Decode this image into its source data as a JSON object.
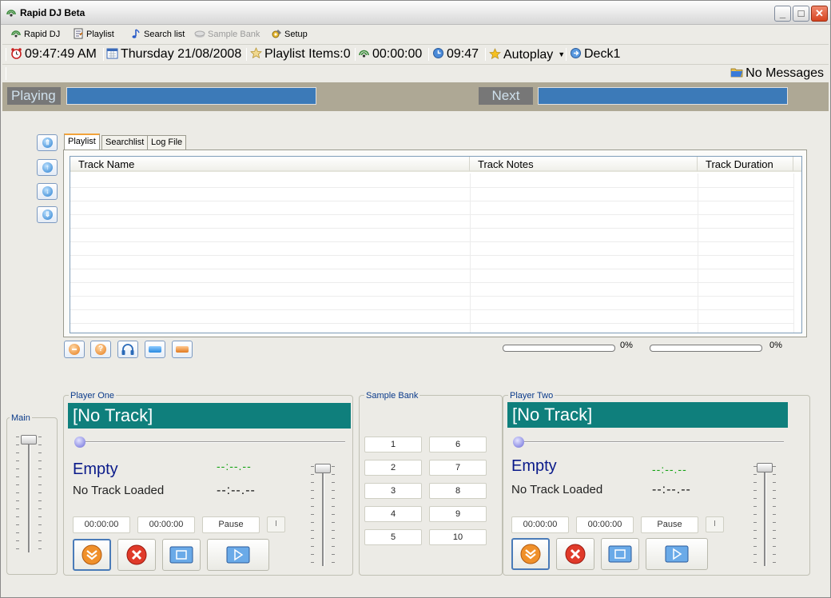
{
  "window": {
    "title": "Rapid DJ Beta"
  },
  "menu": {
    "items": [
      {
        "label": "Rapid DJ",
        "icon": "rapid-dj-icon",
        "enabled": true
      },
      {
        "label": "Playlist",
        "icon": "playlist-icon",
        "enabled": true
      },
      {
        "label": "Search list",
        "icon": "note-icon",
        "enabled": true
      },
      {
        "label": "Sample Bank",
        "icon": "sample-bank-icon",
        "enabled": false
      },
      {
        "label": "Setup",
        "icon": "setup-icon",
        "enabled": true
      }
    ]
  },
  "status": {
    "clock": "09:47:49 AM",
    "date": "Thursday  21/08/2008",
    "playlist_items": "Playlist Items:0",
    "elapsed": "00:00:00",
    "end_time": "09:47",
    "autoplay": "Autoplay",
    "deck": "Deck1"
  },
  "messages": {
    "text": "No Messages"
  },
  "nowbar": {
    "playing_label": "Playing",
    "next_label": "Next",
    "playing_value": "",
    "next_value": ""
  },
  "tabs": [
    {
      "label": "Playlist",
      "active": true
    },
    {
      "label": "Searchlist",
      "active": false
    },
    {
      "label": "Log File",
      "active": false
    }
  ],
  "grid": {
    "columns": [
      "Track Name",
      "Track Notes",
      "Track Duration"
    ],
    "rows": []
  },
  "progress": {
    "left_percent": "0%",
    "right_percent": "0%",
    "left_value": 0,
    "right_value": 0
  },
  "main_volume": {
    "label": "Main",
    "level": 0.95
  },
  "player_one": {
    "label": "Player One",
    "track": "[No Track]",
    "state": "Empty",
    "loaded": "No Track Loaded",
    "time_remaining": "--:--.--",
    "time_total": "--:--.--",
    "position_field": "00:00:00",
    "duration_field": "00:00:00",
    "pause_label": "Pause",
    "small_label": "I",
    "volume_level": 0.95,
    "seek_position": 0
  },
  "player_two": {
    "label": "Player Two",
    "track": "[No Track]",
    "state": "Empty",
    "loaded": "No Track Loaded",
    "time_remaining": "--:--.--",
    "time_total": "--:--.--",
    "position_field": "00:00:00",
    "duration_field": "00:00:00",
    "pause_label": "Pause",
    "small_label": "I",
    "volume_level": 0.95,
    "seek_position": 0
  },
  "sample_bank": {
    "label": "Sample Bank",
    "buttons": [
      "1",
      "2",
      "3",
      "4",
      "5",
      "6",
      "7",
      "8",
      "9",
      "10"
    ]
  },
  "colors": {
    "track_banner": "#0f7f7c",
    "now_field": "#3c7ab8",
    "timer_green": "#13a313"
  }
}
